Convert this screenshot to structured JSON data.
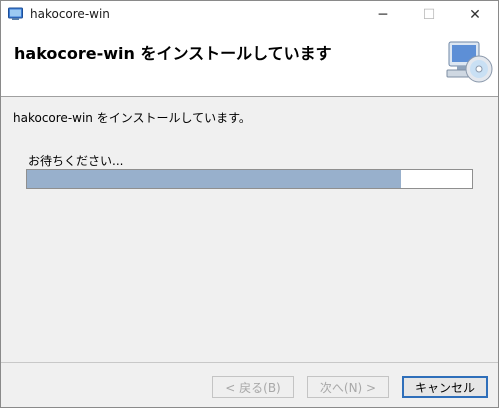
{
  "window": {
    "title": "hakocore-win",
    "controls": {
      "minimize": "─",
      "maximize": "☐",
      "close": "✕"
    },
    "icon": "installer-icon"
  },
  "banner": {
    "title": "hakocore-win をインストールしています",
    "graphic": "computer-disc-icon"
  },
  "body": {
    "status": "hakocore-win をインストールしています。",
    "wait_label": "お待ちください...",
    "progress_percent": 84
  },
  "buttons": {
    "back": "< 戻る(B)",
    "next": "次へ(N) >",
    "cancel": "キャンセル"
  },
  "colors": {
    "progress_fill": "#98b0cc",
    "accent": "#2f6fba"
  }
}
